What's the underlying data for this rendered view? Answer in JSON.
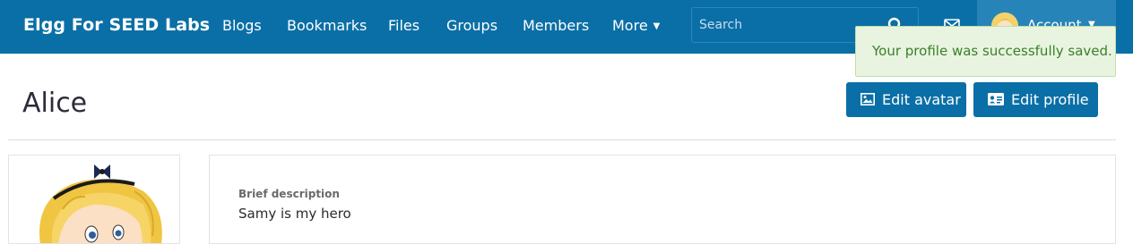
{
  "header": {
    "brand": "Elgg For SEED Labs",
    "nav": {
      "blogs": "Blogs",
      "bookmarks": "Bookmarks",
      "files": "Files",
      "groups": "Groups",
      "members": "Members",
      "more": "More"
    },
    "search_placeholder": "Search",
    "account_label": "Account"
  },
  "flash_message": "Your profile was successfully saved.",
  "profile": {
    "name": "Alice",
    "edit_avatar_label": "Edit avatar",
    "edit_profile_label": "Edit profile",
    "brief_description_label": "Brief description",
    "brief_description_value": "Samy is my hero"
  },
  "colors": {
    "header_bg": "#0a6fa6",
    "account_bg": "#2784b8",
    "flash_bg": "#e8f4e0",
    "flash_text": "#3b7f2a"
  },
  "icons": [
    "search-icon",
    "mail-icon",
    "chevron-down-icon",
    "image-icon",
    "id-card-icon"
  ]
}
